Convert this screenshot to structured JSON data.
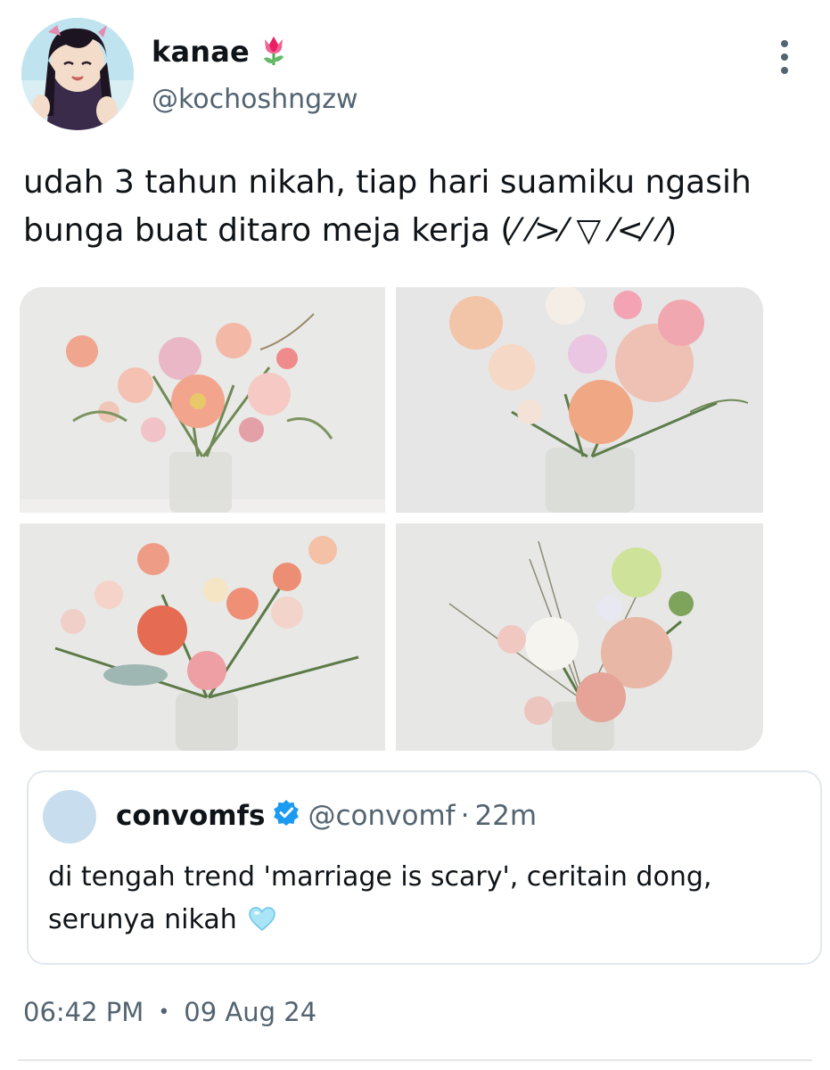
{
  "author": {
    "display_name": "kanae",
    "emoji": "🌷",
    "handle": "@kochoshngzw"
  },
  "tweet": {
    "lines": [
      "udah 3 tahun nikah, tiap hari suamiku ngasih",
      "bunga buat ditaro meja kerja (⁄ ⁄>⁄ ▽ ⁄<⁄ ⁄)"
    ]
  },
  "photos": [
    "flower-bouquet-1",
    "flower-bouquet-2",
    "flower-bouquet-3",
    "flower-bouquet-4"
  ],
  "quoted": {
    "display_name": "convomfs",
    "handle": "@convomf",
    "dot": "·",
    "time": "22m",
    "lines": [
      "di tengah trend 'marriage is scary', ceritain dong,",
      "serunya nikah"
    ],
    "emoji": "light-blue-heart"
  },
  "meta": {
    "time": "06:42 PM",
    "separator": "•",
    "date": "09 Aug 24"
  },
  "colors": {
    "text": "#0f1419",
    "secondary": "#536471",
    "verified": "#1d9bf0",
    "border": "#e1e8ed"
  }
}
